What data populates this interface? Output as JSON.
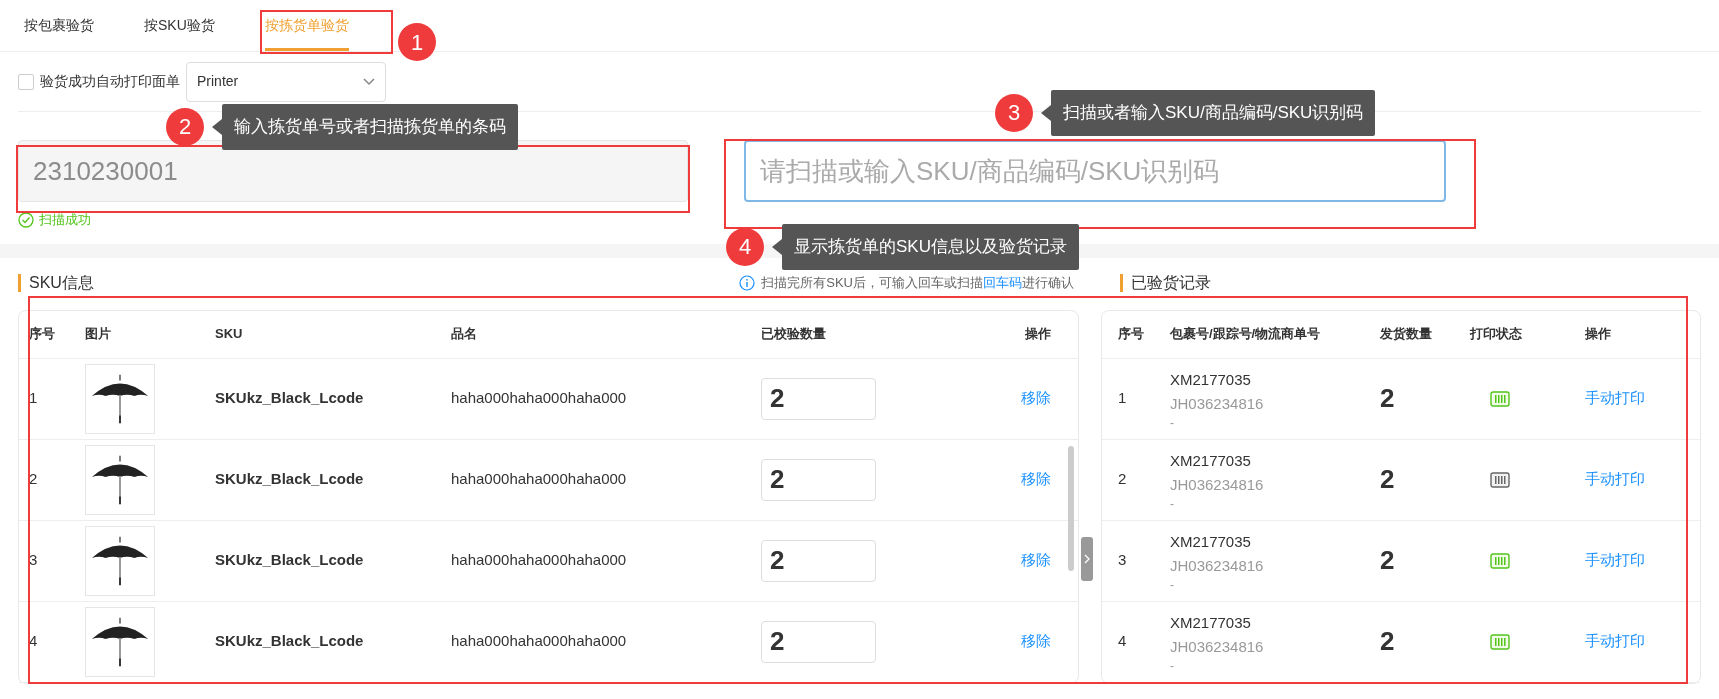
{
  "tabs": [
    {
      "label": "按包裹验货",
      "selected": false
    },
    {
      "label": "按SKU验货",
      "selected": false
    },
    {
      "label": "按拣货单验货",
      "selected": true
    }
  ],
  "auto_print": {
    "label": "验货成功自动打印面单",
    "checked": false
  },
  "printer_select": {
    "value": "Printer"
  },
  "pick_list_field": {
    "value": "2310230001"
  },
  "scan_status": "扫描成功",
  "sku_field": {
    "placeholder": "请扫描或输入SKU/商品编码/SKU识别码"
  },
  "sku_section": {
    "title": "SKU信息",
    "hint_before": "扫描完所有SKU后，可输入回车或扫描",
    "hint_link": "回车码",
    "hint_after": "进行确认",
    "columns": [
      "序号",
      "图片",
      "SKU",
      "品名",
      "已校验数量",
      "操作"
    ],
    "rows": [
      {
        "index": "1",
        "sku": "SKUkz_Black_Lcode",
        "name": "haha000haha000haha000",
        "quantity": "2",
        "action": "移除"
      },
      {
        "index": "2",
        "sku": "SKUkz_Black_Lcode",
        "name": "haha000haha000haha000",
        "quantity": "2",
        "action": "移除"
      },
      {
        "index": "3",
        "sku": "SKUkz_Black_Lcode",
        "name": "haha000haha000haha000",
        "quantity": "2",
        "action": "移除"
      },
      {
        "index": "4",
        "sku": "SKUkz_Black_Lcode",
        "name": "haha000haha000haha000",
        "quantity": "2",
        "action": "移除"
      }
    ]
  },
  "records_section": {
    "title": "已验货记录",
    "columns": [
      "序号",
      "包裹号/跟踪号/物流商单号",
      "发货数量",
      "打印状态",
      "操作"
    ],
    "rows": [
      {
        "index": "1",
        "package_no": "XM2177035",
        "tracking_no": "JH036234816",
        "carrier_no": "-",
        "quantity": "2",
        "printed": true,
        "action": "手动打印"
      },
      {
        "index": "2",
        "package_no": "XM2177035",
        "tracking_no": "JH036234816",
        "carrier_no": "-",
        "quantity": "2",
        "printed": false,
        "action": "手动打印"
      },
      {
        "index": "3",
        "package_no": "XM2177035",
        "tracking_no": "JH036234816",
        "carrier_no": "-",
        "quantity": "2",
        "printed": true,
        "action": "手动打印"
      },
      {
        "index": "4",
        "package_no": "XM2177035",
        "tracking_no": "JH036234816",
        "carrier_no": "-",
        "quantity": "2",
        "printed": true,
        "action": "手动打印"
      }
    ]
  },
  "annotations": [
    {
      "number": "1"
    },
    {
      "number": "2",
      "text": "输入拣货单号或者扫描拣货单的条码"
    },
    {
      "number": "3",
      "text": "扫描或者输入SKU/商品编码/SKU识别码"
    },
    {
      "number": "4",
      "text": "显示拣货单的SKU信息以及验货记录"
    }
  ]
}
